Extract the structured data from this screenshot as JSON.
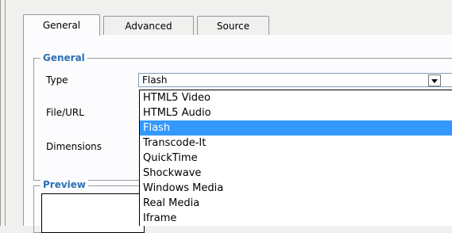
{
  "tabs": [
    {
      "label": "General",
      "active": true
    },
    {
      "label": "Advanced",
      "active": false
    },
    {
      "label": "Source",
      "active": false
    }
  ],
  "general_section": {
    "legend": "General",
    "type_label": "Type",
    "file_label": "File/URL",
    "dimensions_label": "Dimensions"
  },
  "type_select": {
    "value": "Flash",
    "arrow_icon": "chevron-down-icon",
    "options": [
      "HTML5 Video",
      "HTML5 Audio",
      "Flash",
      "Transcode-It",
      "QuickTime",
      "Shockwave",
      "Windows Media",
      "Real Media",
      "Iframe"
    ],
    "highlighted": "Flash"
  },
  "preview_section": {
    "legend": "Preview"
  },
  "colors": {
    "legend_text": "#2b6fb6",
    "selection": "#3399ff"
  }
}
